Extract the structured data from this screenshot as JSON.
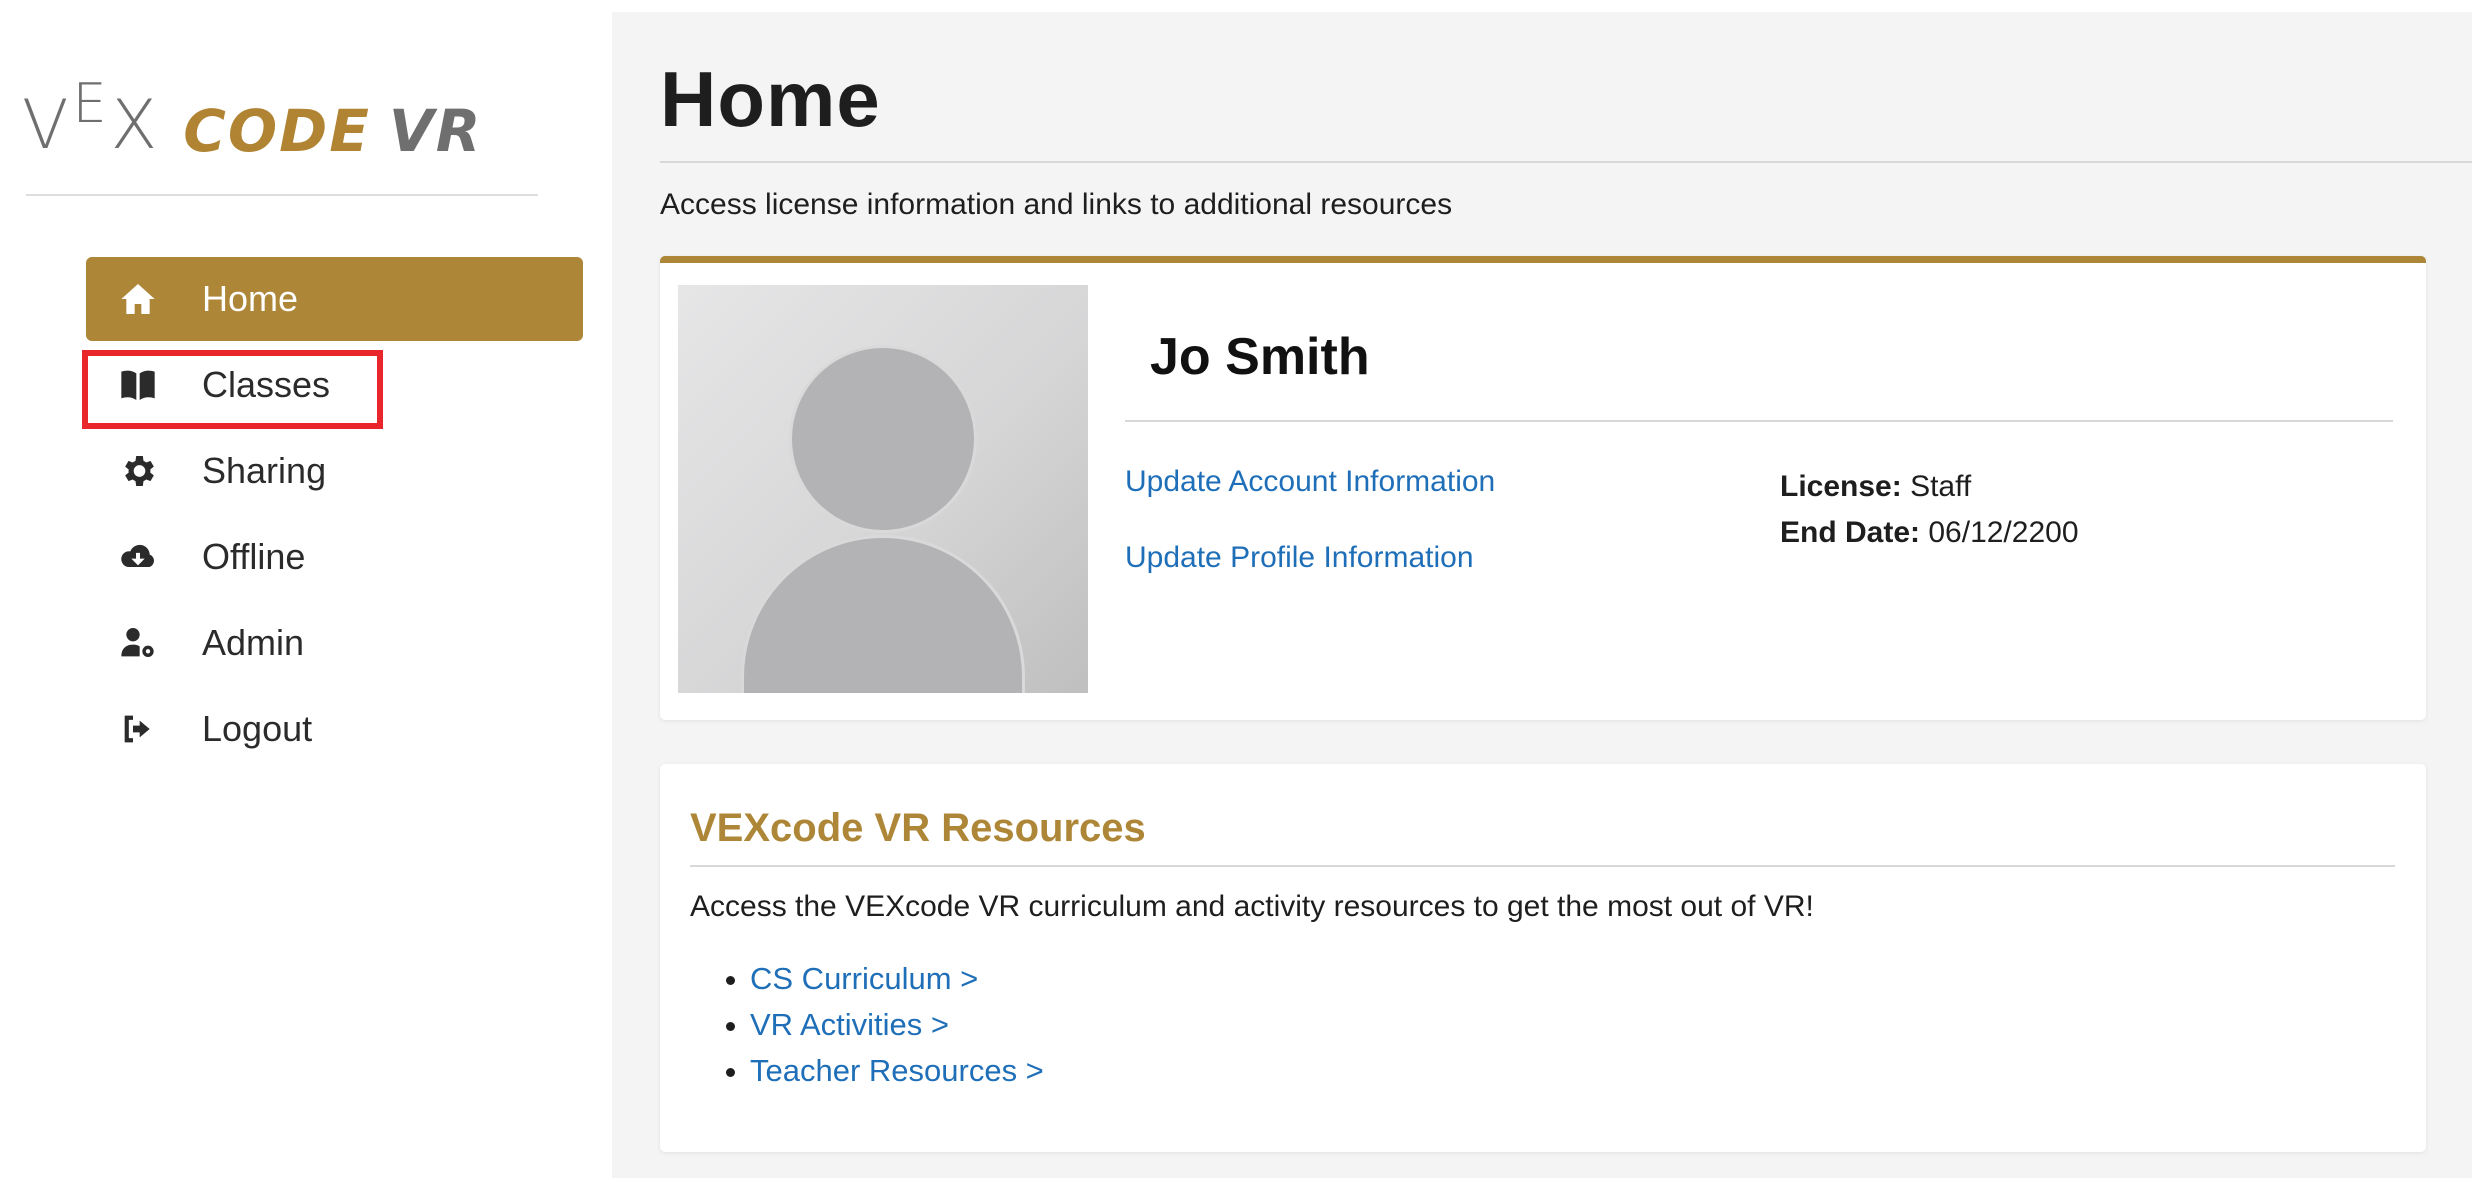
{
  "logo": {
    "vex_left": "V",
    "vex_e": "E",
    "vex_right": "X",
    "code": "CODE",
    "vr": "VR"
  },
  "sidebar": {
    "items": [
      {
        "label": "Home",
        "icon": "home-icon",
        "active": true
      },
      {
        "label": "Classes",
        "icon": "book-icon",
        "active": false
      },
      {
        "label": "Sharing",
        "icon": "gear-icon",
        "active": false
      },
      {
        "label": "Offline",
        "icon": "cloud-download-icon",
        "active": false
      },
      {
        "label": "Admin",
        "icon": "user-cog-icon",
        "active": false
      },
      {
        "label": "Logout",
        "icon": "logout-icon",
        "active": false
      }
    ]
  },
  "colors": {
    "accent": "#ad8637",
    "link": "#1f6fb8",
    "highlight": "#e8262b"
  },
  "main": {
    "title": "Home",
    "subtitle": "Access license information and links to additional resources",
    "profile": {
      "name": "Jo Smith",
      "update_account": "Update Account Information",
      "update_profile": "Update Profile Information",
      "license_label": "License:",
      "license_value": "Staff",
      "end_date_label": "End Date:",
      "end_date_value": "06/12/2200"
    },
    "resources": {
      "title": "VEXcode VR Resources",
      "description": "Access the VEXcode VR curriculum and activity resources to get the most out of VR!",
      "links": [
        "CS Curriculum >",
        "VR Activities >",
        "Teacher Resources >"
      ]
    }
  }
}
